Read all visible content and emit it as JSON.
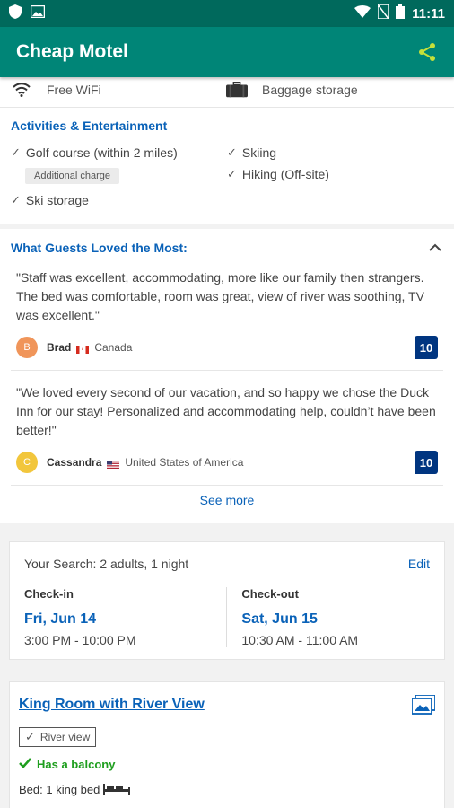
{
  "status_bar": {
    "time": "11:11"
  },
  "app_bar": {
    "title": "Cheap Motel"
  },
  "amenities": [
    {
      "label": "Free WiFi",
      "icon": "wifi-icon"
    },
    {
      "label": "Baggage storage",
      "icon": "luggage-icon"
    }
  ],
  "activities": {
    "title": "Activities & Entertainment",
    "left": [
      {
        "label": "Golf course (within 2 miles)",
        "chip": "Additional charge"
      },
      {
        "label": "Ski storage"
      }
    ],
    "right": [
      {
        "label": "Skiing"
      },
      {
        "label": "Hiking (Off-site)"
      }
    ]
  },
  "reviews": {
    "title": "What Guests Loved the Most:",
    "items": [
      {
        "text": "\"Staff was excellent, accommodating, more like our family then strangers. The bed was comfortable, room was great, view of river was soothing, TV was excellent.\"",
        "initial": "B",
        "avatar_color": "#f0955a",
        "name": "Brad",
        "country": "Canada",
        "score": "10"
      },
      {
        "text": "\"We loved every second of our vacation, and so happy we chose the Duck Inn for our stay! Personalized and accommodating help, couldn’t have been better!\"",
        "initial": "C",
        "avatar_color": "#f2c63c",
        "name": "Cassandra",
        "country": "United States of America",
        "score": "10"
      }
    ],
    "see_more": "See more"
  },
  "search": {
    "summary": "Your Search: 2 adults, 1 night",
    "edit": "Edit",
    "checkin_label": "Check-in",
    "checkin_date": "Fri, Jun 14",
    "checkin_time": "3:00 PM - 10:00 PM",
    "checkout_label": "Check-out",
    "checkout_date": "Sat, Jun 15",
    "checkout_time": "10:30 AM - 11:00 AM"
  },
  "room": {
    "title": "King Room with River View",
    "view_chip": "River view",
    "balcony": "Has a balcony",
    "bed": "Bed: 1 king bed"
  }
}
